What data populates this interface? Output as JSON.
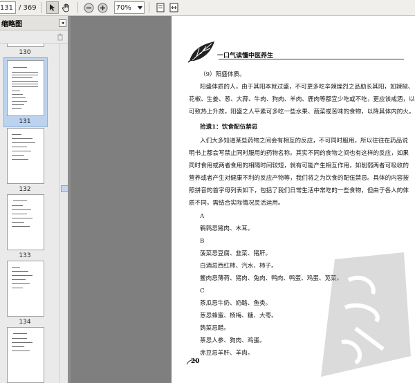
{
  "toolbar": {
    "current_page": "131",
    "total_pages": "/ 369",
    "zoom": "70%"
  },
  "panel": {
    "title": "缩略图"
  },
  "thumbnails": [
    {
      "label": "130"
    },
    {
      "label": "131",
      "selected": true
    },
    {
      "label": "132"
    },
    {
      "label": "133"
    },
    {
      "label": "134"
    },
    {
      "label": ""
    }
  ],
  "page": {
    "header_title": "一口气读懂中医养生",
    "page_number": "20",
    "lines": [
      "（9）阳盛体质。",
      "阳盛体质的人，由于其阳本就过盛，不可更多吃辛辣燥烈之品助长其阳，如辣椒、",
      "花椒、生姜、葱、大蒜、牛肉、狗肉、羊肉、鹿肉等都宜少吃或不吃，更应该戒酒，以其",
      "可致热上升故。阳盛之人平素可多吃一些水果、蔬菜或苦味的食物，以降其体内的火。",
      "拾遗1：饮食配伍禁忌",
      "入们大多知道某些药物之间会有相互的反应，不可同时服用，所以往往在药品说",
      "明书上都会写禁止同时服用的药物名称。其实不同的食物之间也有这样的反应，如果",
      "同时食用或两者食用的相隔时间较短，就有可能产生相互作用，如削弱两者可吸收的",
      "营养或者产生对健康不利的反应产物等，我们将之为饮食的配伍禁忌。具体的内容按",
      "照拼音的首字母列表如下，包括了我们日常生活中常吃的一些食物，但由于各人的体",
      "质不同，需结合实际情况灵活运用。",
      "A",
      "鹌鹑忌猪肉、木耳。",
      "B",
      "菠菜忌豆腐、韭菜、猪肝。",
      "白酒忌西红柿、汽水、柿子。",
      "鳖肉忌薄荷、猪肉、兔肉、鸭肉、鸭蛋、鸡蛋、苋菜。",
      "C",
      "茶瓜忌牛奶、奶酪、鱼类。",
      "葱忌蜂蜜、杨梅、糖、大枣。",
      "蒟菜忌醋。",
      "茶忌人参、狗肉、鸡蛋。",
      "赤豆忌羊肝、羊肉。"
    ]
  },
  "colors": {
    "toolbar_bg": "#f0efec",
    "panel_bg": "#eaeaea",
    "doc_bg": "#7f7f7f",
    "selection": "#bcd3ef"
  }
}
